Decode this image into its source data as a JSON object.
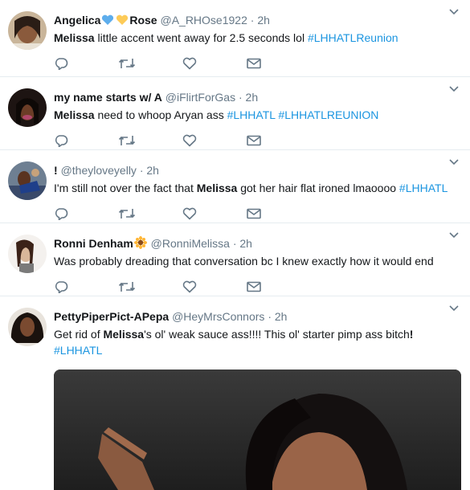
{
  "tweets": [
    {
      "name": "Angelica",
      "name_suffix": "Rose",
      "handle": "@A_RHOse1922",
      "time": "2h",
      "text": {
        "plain": "little accent went away for 2.5 seconds lol",
        "bold": "Melissa",
        "tags": [
          "#LHHATLReunion"
        ]
      }
    },
    {
      "name": "my name starts w/ A",
      "handle": "@iFlirtForGas",
      "time": "2h",
      "text": {
        "bold": "Melissa",
        "plain": "need to whoop Aryan ass",
        "tags": [
          "#LHHATL",
          "#LHHATLREUNION"
        ]
      }
    },
    {
      "name": "!",
      "handle": "@theyloveyelly",
      "time": "2h",
      "text": {
        "pre": "I'm still not over the fact that",
        "bold": "Melissa",
        "post": "got her hair flat ironed lmaoooo",
        "tags": [
          "#LHHATL"
        ]
      }
    },
    {
      "name": "Ronni Denham",
      "handle": "@RonniMelissa",
      "time": "2h",
      "text": {
        "plain": "Was probably dreading that conversation bc I knew exactly how it would end"
      }
    },
    {
      "name": "PettyPiperPict-APepa",
      "handle": "@HeyMrsConnors",
      "time": "2h",
      "text": {
        "pre": "Get rid of",
        "bold": "Melissa",
        "post": "'s ol' weak sauce ass!!!! This ol' starter pimp ass bitch",
        "end": "!",
        "tags": [
          "#LHHATL"
        ]
      }
    }
  ],
  "separator": "·",
  "icons": [
    "reply-icon",
    "retweet-icon",
    "like-icon",
    "direct-message-icon",
    "chevron-down-icon",
    "heart-emoji-icon",
    "sunflower-emoji-icon"
  ],
  "colors": {
    "hashtag": "#1b95e0",
    "meta": "#657786",
    "icon": "#657786",
    "divider": "#e6ecf0"
  }
}
